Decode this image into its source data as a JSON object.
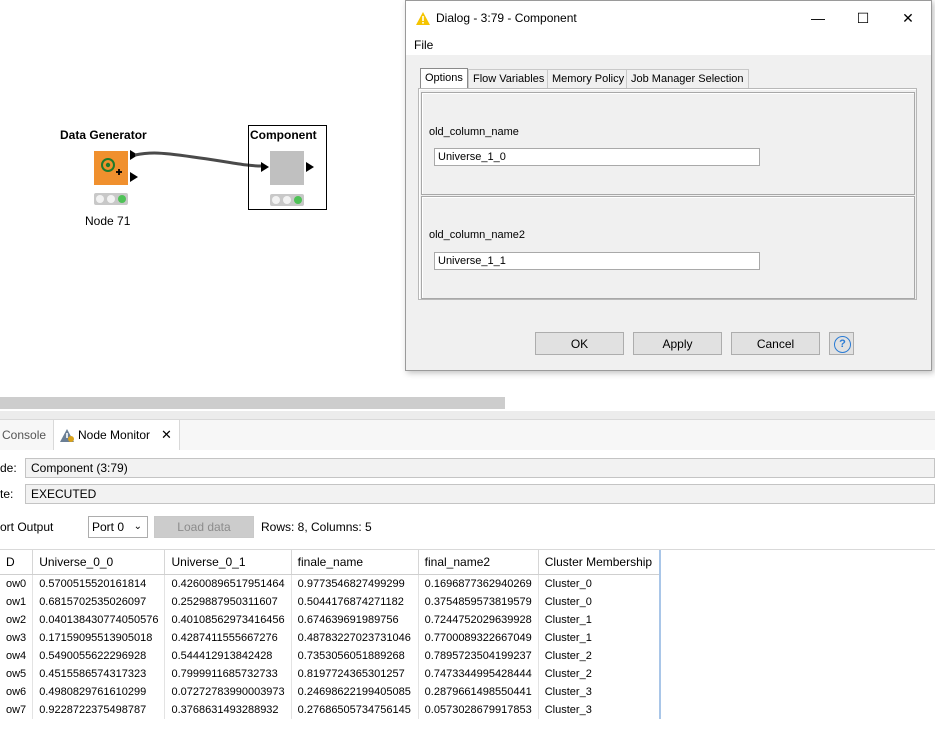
{
  "workflow": {
    "node1": {
      "title": "Data Generator",
      "label": "Node 71"
    },
    "node2": {
      "title": "Component"
    }
  },
  "dialog": {
    "title": "Dialog - 3:79 - Component",
    "menu": [
      "File"
    ],
    "tabs": [
      "Options",
      "Flow Variables",
      "Memory Policy",
      "Job Manager Selection"
    ],
    "active_tab": "Options",
    "fields": [
      {
        "label": "old_column_name",
        "value": "Universe_1_0"
      },
      {
        "label": "old_column_name2",
        "value": "Universe_1_1"
      }
    ],
    "buttons": {
      "ok": "OK",
      "apply": "Apply",
      "cancel": "Cancel",
      "help": "?"
    }
  },
  "bottom": {
    "tabs": {
      "console": "Console",
      "node_monitor": "Node Monitor"
    },
    "node_label": "de:",
    "node_value": "Component  (3:79)",
    "state_label": "te:",
    "state_value": "EXECUTED",
    "port_output_label": "ort Output",
    "port_select": "Port 0",
    "load_button": "Load data",
    "summary": "Rows: 8, Columns: 5"
  },
  "table": {
    "columns": [
      "D",
      "Universe_0_0",
      "Universe_0_1",
      "finale_name",
      "final_name2",
      "Cluster Membership"
    ],
    "rows": [
      [
        "ow0",
        "0.5700515520161814",
        "0.42600896517951464",
        "0.9773546827499299",
        "0.1696877362940269",
        "Cluster_0"
      ],
      [
        "ow1",
        "0.6815702535026097",
        "0.2529887950311607",
        "0.5044176874271182",
        "0.3754859573819579",
        "Cluster_0"
      ],
      [
        "ow2",
        "0.040138430774050576",
        "0.40108562973416456",
        "0.674639691989756",
        "0.7244752029639928",
        "Cluster_1"
      ],
      [
        "ow3",
        "0.17159095513905018",
        "0.4287411555667276",
        "0.48783227023731046",
        "0.7700089322667049",
        "Cluster_1"
      ],
      [
        "ow4",
        "0.5490055622296928",
        "0.544412913842428",
        "0.7353056051889268",
        "0.7895723504199237",
        "Cluster_2"
      ],
      [
        "ow5",
        "0.4515586574317323",
        "0.7999911685732733",
        "0.8197724365301257",
        "0.7473344995428444",
        "Cluster_2"
      ],
      [
        "ow6",
        "0.4980829761610299",
        "0.07272783990003973",
        "0.24698622199405085",
        "0.2879661498550441",
        "Cluster_3"
      ],
      [
        "ow7",
        "0.9228722375498787",
        "0.3768631493288932",
        "0.27686505734756145",
        "0.0573028679917853",
        "Cluster_3"
      ]
    ]
  },
  "colors": {
    "data_generator": "#f0902e",
    "component_body": "#c0c0c0",
    "traffic_green": "#4fc257",
    "warning_yellow": "#f5c400"
  }
}
